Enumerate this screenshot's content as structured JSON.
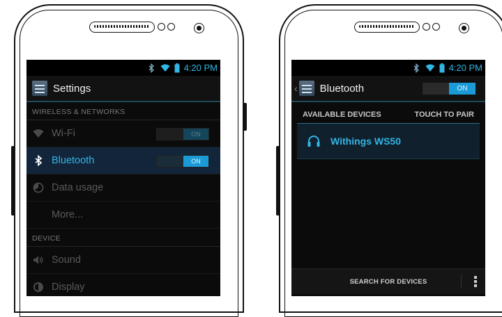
{
  "left_screen": {
    "status_time": "4:20 PM",
    "title": "Settings",
    "sections": [
      {
        "header": "WIRELESS & NETWORKS"
      },
      {
        "header": "DEVICE"
      }
    ],
    "items": [
      {
        "label": "Wi-Fi",
        "icon": "wifi-icon",
        "toggle": "ON"
      },
      {
        "label": "Bluetooth",
        "icon": "bluetooth-icon",
        "toggle": "ON"
      },
      {
        "label": "Data usage",
        "icon": "data-usage-icon"
      },
      {
        "label": "More..."
      },
      {
        "label": "Sound",
        "icon": "sound-icon"
      },
      {
        "label": "Display",
        "icon": "display-icon"
      }
    ]
  },
  "right_screen": {
    "status_time": "4:20 PM",
    "title": "Bluetooth",
    "toggle": "ON",
    "available_devices_label": "AVAILABLE DEVICES",
    "touch_to_pair_label": "TOUCH TO PAIR",
    "device_name": "Withings WS50",
    "device_icon": "headphones-icon",
    "search_label": "SEARCH FOR DEVICES"
  },
  "colors": {
    "accent": "#33b5e5",
    "toggle_on": "#1a9bd7",
    "screen_bg": "#0b0b0b"
  }
}
